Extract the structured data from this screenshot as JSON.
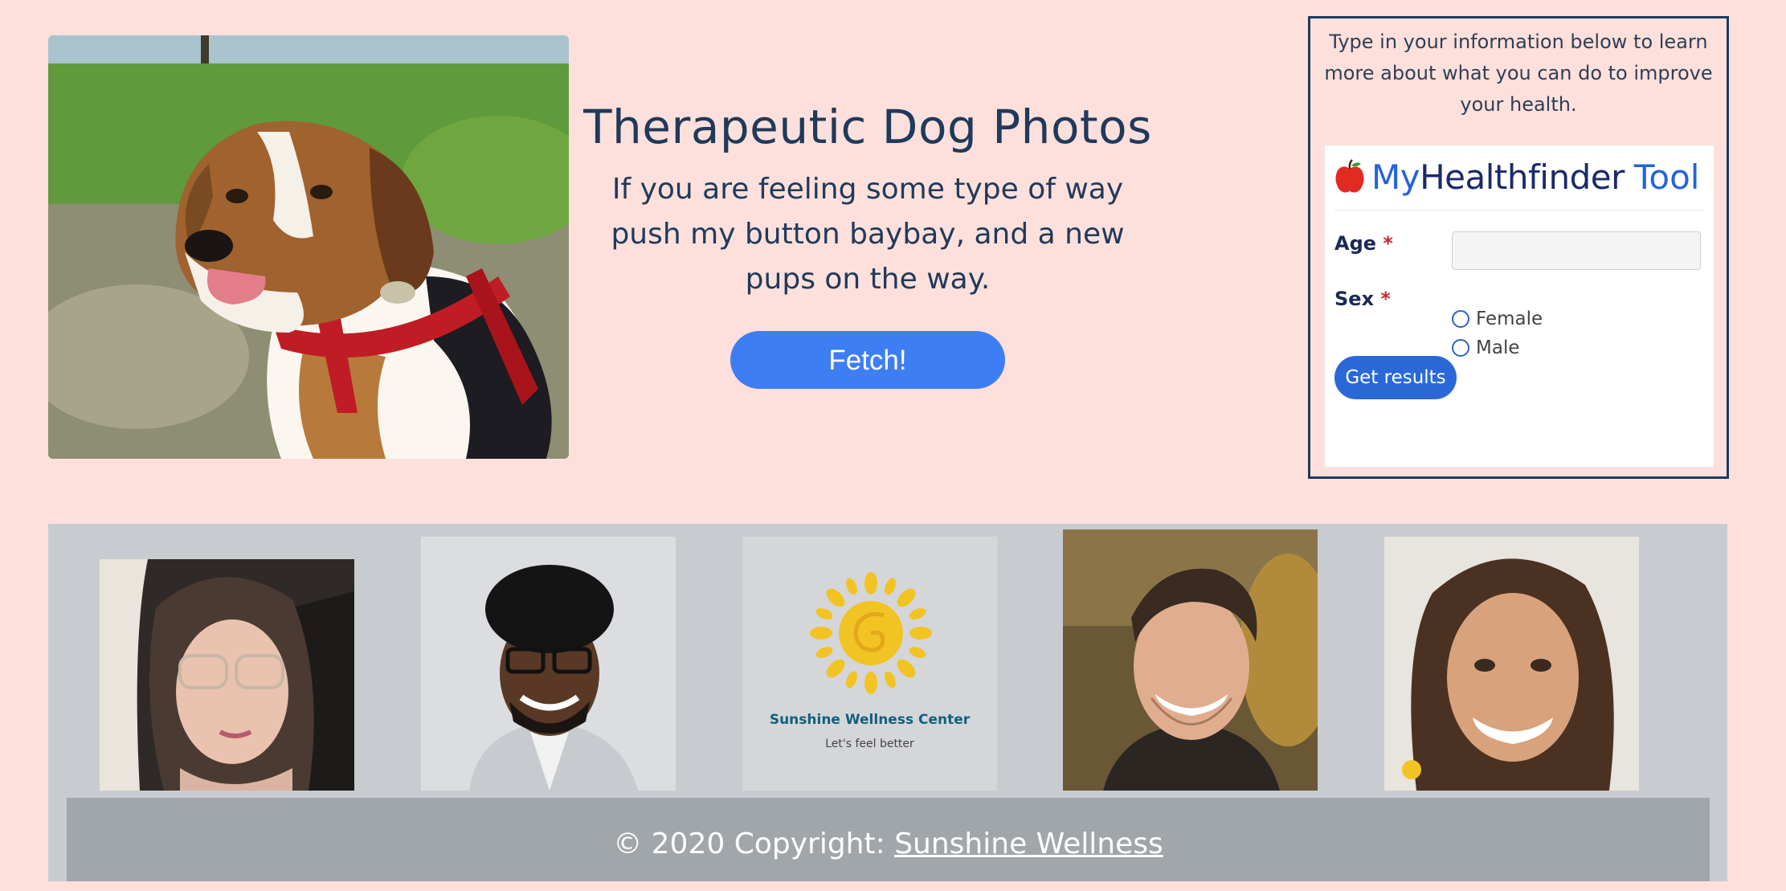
{
  "hero": {
    "title": "Therapeutic Dog Photos",
    "subtitle": "If you are feeling some type of way push my button baybay, and a new pups on the way.",
    "fetch_label": "Fetch!"
  },
  "healthfinder": {
    "intro": "Type in your information below to learn more about what you can do to improve your health.",
    "logo_my": "My",
    "logo_name": "Healthfinder",
    "logo_tool": "Tool",
    "age_label": "Age",
    "sex_label": "Sex",
    "required_mark": "*",
    "age_value": "",
    "options": [
      "Female",
      "Male"
    ],
    "submit_label": "Get results"
  },
  "gallery": {
    "logo_name": "Sunshine Wellness Center",
    "logo_tagline": "Let's feel better"
  },
  "footer": {
    "prefix": "© 2020 Copyright: ",
    "link_label": "Sunshine Wellness"
  },
  "colors": {
    "page_bg": "#fde0dc",
    "accent": "#3e7ef4",
    "gallery_bg": "#c8ccd0",
    "footer_bg": "#a0a6aa"
  }
}
